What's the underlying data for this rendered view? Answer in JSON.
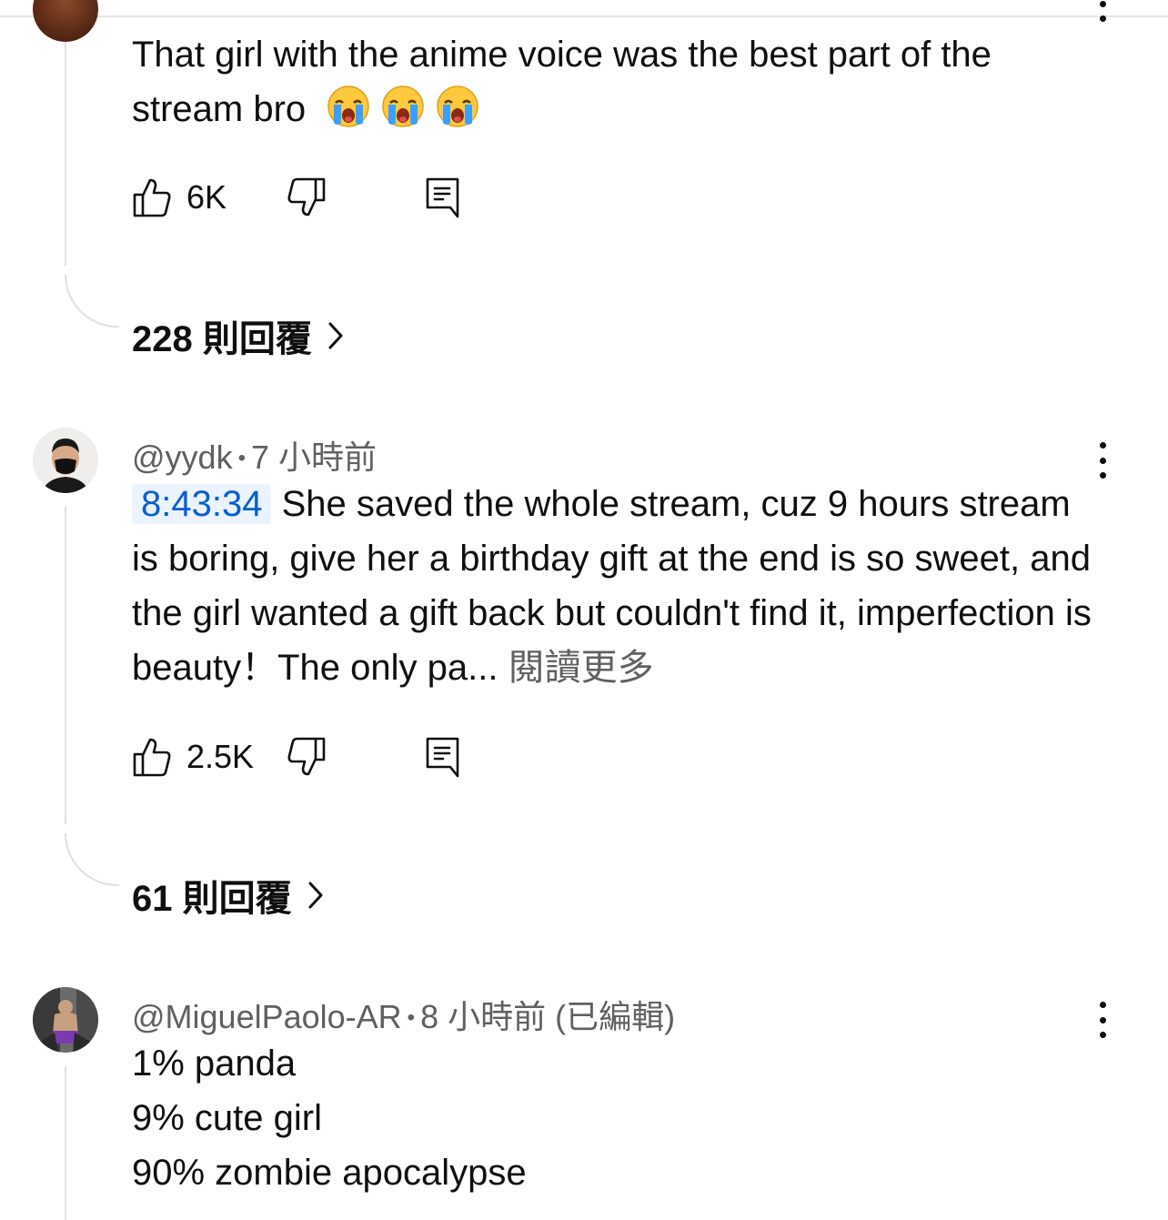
{
  "comments": [
    {
      "text": "That girl with the anime voice was the best part of the stream bro",
      "emoji_count": 3,
      "emoji_name": "loudly-crying-face",
      "likes": "6K",
      "replies_label": "228 則回覆"
    },
    {
      "handle": "@yydk",
      "time": "7 小時前",
      "timestamp_link": "8:43:34",
      "text": "She saved the whole stream, cuz 9 hours stream is boring, give her a birthday gift at the end is so sweet, and the girl wanted a gift back but couldn't find it, imperfection is beauty！The only pa...",
      "read_more": "閱讀更多",
      "likes": "2.5K",
      "replies_label": "61 則回覆"
    },
    {
      "handle": "@MiguelPaolo-AR",
      "time": "8 小時前 (已編輯)",
      "lines": [
        "1% panda",
        "9% cute girl",
        "90% zombie apocalypse"
      ]
    }
  ],
  "colors": {
    "text": "#0f0f0f",
    "secondary": "#606060",
    "link": "#065fd4",
    "link_bg": "#eaf3ff",
    "thread_line": "#e0e0e0"
  }
}
